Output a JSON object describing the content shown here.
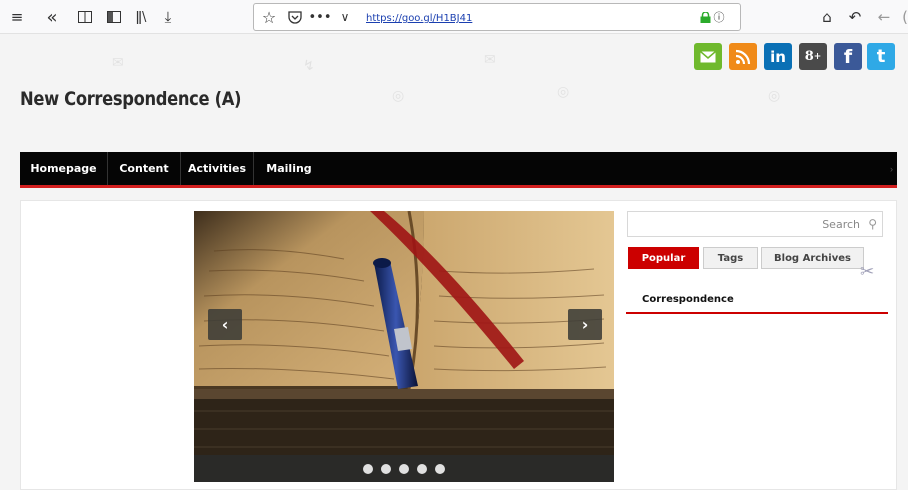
{
  "browser": {
    "url": "https://goo.gl/H1BJ41",
    "icons": [
      "menu-icon",
      "back-double-icon",
      "reader-icon",
      "sidebar-icon",
      "library-icon",
      "download-icon",
      "star-icon",
      "pocket-icon",
      "more-icon",
      "chevron-down-icon",
      "lock-icon",
      "info-icon",
      "home-icon",
      "undo-icon",
      "back-icon"
    ]
  },
  "site": {
    "title": "New Correspondence (A)"
  },
  "social": [
    {
      "name": "email",
      "glyph": "✉",
      "color": "#6fb92d"
    },
    {
      "name": "rss",
      "glyph": "◗",
      "color": "#f08a18"
    },
    {
      "name": "linkedin",
      "glyph": "in",
      "color": "#0a70b5"
    },
    {
      "name": "googleplus",
      "glyph": "8+",
      "color": "#4a4a4a"
    },
    {
      "name": "facebook",
      "glyph": "f",
      "color": "#3b5998"
    },
    {
      "name": "twitter",
      "glyph": "t",
      "color": "#2fa9e6"
    }
  ],
  "nav": {
    "items": [
      "Homepage",
      "Content",
      "Activities",
      "Mailing"
    ]
  },
  "slider": {
    "prev": "‹",
    "next": "›",
    "dot_count": 5,
    "active_dot": 1
  },
  "sidebar": {
    "search_placeholder": "Search",
    "tabs": [
      "Popular",
      "Tags",
      "Blog Archives"
    ],
    "active_tab": 0,
    "list": [
      "Correspondence"
    ]
  },
  "colors": {
    "accent": "#cc0000",
    "nav_bg": "#050505"
  }
}
